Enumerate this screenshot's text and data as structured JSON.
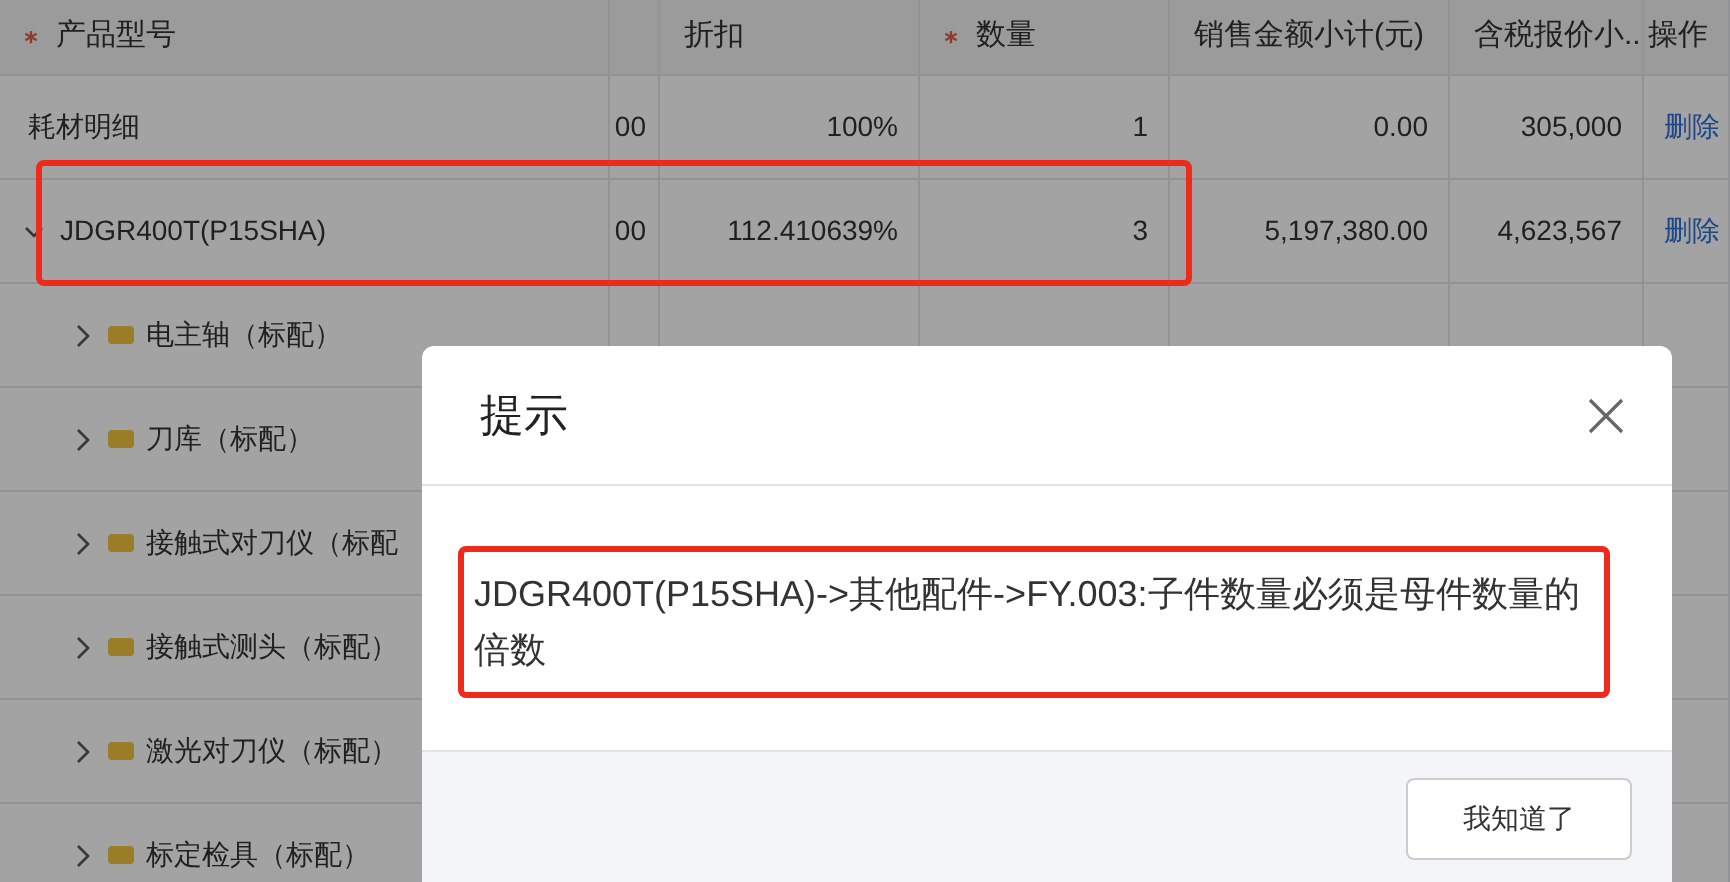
{
  "table": {
    "columns": [
      {
        "label": "产品型号",
        "required": true
      },
      {
        "label": "折扣",
        "required": false
      },
      {
        "label": "数量",
        "required": true
      },
      {
        "label": "销售金额小计(元)",
        "required": false
      },
      {
        "label": "含税报价小..",
        "required": false
      },
      {
        "label": "操作",
        "required": false
      }
    ],
    "rows": [
      {
        "name": "耗材明细",
        "column_2": "00",
        "discount": "100%",
        "quantity": "1",
        "amount": "0.00",
        "quote": "305,000",
        "action": "删除"
      },
      {
        "name": "JDGR400T(P15SHA)",
        "expanded": true,
        "column_2": "00",
        "discount": "112.410639%",
        "quantity": "3",
        "amount": "5,197,380.00",
        "quote": "4,623,567",
        "action": "删除",
        "children": [
          {
            "name": "电主轴（标配）",
            "expanded": false
          },
          {
            "name": "刀库（标配）",
            "expanded": false
          },
          {
            "name": "接触式对刀仪（标配",
            "expanded": false
          },
          {
            "name": "接触式测头（标配）",
            "expanded": false
          },
          {
            "name": "激光对刀仪（标配）",
            "expanded": false
          },
          {
            "name": "标定检具（标配）",
            "expanded": false
          }
        ]
      }
    ]
  },
  "dialog": {
    "title": "提示",
    "message": "JDGR400T(P15SHA)->其他配件->FY.003:子件数量必须是母件数量的倍数",
    "button": "我知道了"
  }
}
